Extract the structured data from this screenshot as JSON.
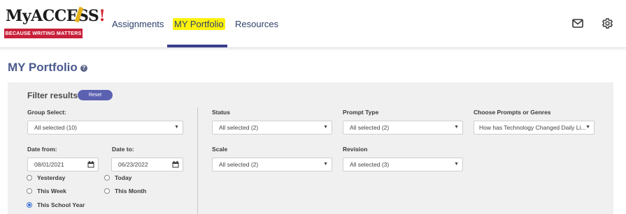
{
  "header": {
    "logo": {
      "wordmark": "MyACCESS",
      "exclamation": "!",
      "tagline": "BECAUSE WRITING MATTERS"
    },
    "nav": [
      {
        "label": "Assignments",
        "active": false
      },
      {
        "label": "MY Portfolio",
        "active": true
      },
      {
        "label": "Resources",
        "active": false
      }
    ],
    "icons": [
      "mail-icon",
      "gear-icon"
    ],
    "active_underline_color": "#3b3e8c",
    "highlight_color": "#fdf20b"
  },
  "page": {
    "title": "MY Portfolio",
    "help_glyph": "?"
  },
  "filters": {
    "title": "Filter results",
    "reset_label": "Reset",
    "group_select": {
      "label": "Group Select:",
      "value": "All selected (10)"
    },
    "date_from": {
      "label": "Date from:",
      "value": "08/01/2021"
    },
    "date_to": {
      "label": "Date to:",
      "value": "06/23/2022"
    },
    "date_presets": [
      {
        "label": "Yesterday",
        "selected": false
      },
      {
        "label": "Today",
        "selected": false
      },
      {
        "label": "This Week",
        "selected": false
      },
      {
        "label": "This Month",
        "selected": false
      },
      {
        "label": "This School Year",
        "selected": true
      }
    ],
    "status": {
      "label": "Status",
      "value": "All selected (2)"
    },
    "prompt_type": {
      "label": "Prompt Type",
      "value": "All selected (2)"
    },
    "prompts_or_genres": {
      "label": "Choose Prompts or Genres",
      "value": "How has Technology Changed Daily Li..."
    },
    "scale": {
      "label": "Scale",
      "value": "All selected (2)"
    },
    "revision": {
      "label": "Revision",
      "value": "All selected (3)"
    }
  },
  "colors": {
    "accent": "#5b61b1",
    "title": "#4a5a8c",
    "panel_bg": "#f0f0f0"
  }
}
